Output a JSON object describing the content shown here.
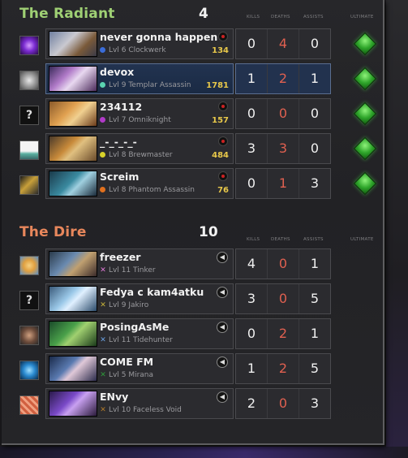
{
  "radiant": {
    "name": "The Radiant",
    "score": "4",
    "color": "#9fd074",
    "headers": {
      "kills": "KILLS",
      "deaths": "DEATHS",
      "assists": "ASSISTS",
      "ultimate": "ULTIMATE"
    },
    "players": [
      {
        "name": "never gonna happen",
        "level": "Lvl 6",
        "hero": "Clockwerk",
        "gold": "134",
        "kills": "0",
        "deaths": "4",
        "assists": "0",
        "dot_color": "#3a6cd8",
        "avatar_icon": "purple-figure-avatar",
        "portrait_icon": "clockwerk-portrait",
        "status_icon": "record-icon",
        "ultimate_ready": true
      },
      {
        "name": "devox",
        "level": "Lvl 9",
        "hero": "Templar Assassin",
        "gold": "1781",
        "kills": "1",
        "deaths": "2",
        "assists": "1",
        "dot_color": "#5ad3b0",
        "avatar_icon": "statue-avatar",
        "portrait_icon": "templar-assassin-portrait",
        "status_icon": "",
        "ultimate_ready": true
      },
      {
        "name": "234112",
        "level": "Lvl 7",
        "hero": "Omniknight",
        "gold": "157",
        "kills": "0",
        "deaths": "0",
        "assists": "0",
        "dot_color": "#b03ac8",
        "avatar_icon": "question-avatar",
        "portrait_icon": "omniknight-portrait",
        "status_icon": "record-icon",
        "ultimate_ready": true
      },
      {
        "name": "_-_-_-_-",
        "level": "Lvl 8",
        "hero": "Brewmaster",
        "gold": "484",
        "kills": "3",
        "deaths": "3",
        "assists": "0",
        "dot_color": "#d8d22a",
        "avatar_icon": "landscape-avatar",
        "portrait_icon": "brewmaster-portrait",
        "status_icon": "record-icon",
        "ultimate_ready": true
      },
      {
        "name": "Screim",
        "level": "Lvl 8",
        "hero": "Phantom Assassin",
        "gold": "76",
        "kills": "0",
        "deaths": "1",
        "assists": "3",
        "dot_color": "#e0701e",
        "avatar_icon": "suit-man-avatar",
        "portrait_icon": "phantom-assassin-portrait",
        "status_icon": "record-icon",
        "ultimate_ready": true
      }
    ]
  },
  "dire": {
    "name": "The Dire",
    "score": "10",
    "color": "#e8875c",
    "headers": {
      "kills": "KILLS",
      "deaths": "DEATHS",
      "assists": "ASSISTS",
      "ultimate": "ULTIMATE"
    },
    "players": [
      {
        "name": "freezer",
        "level": "Lvl 11",
        "hero": "Tinker",
        "kills": "4",
        "deaths": "0",
        "assists": "1",
        "x_color": "#e07ad8",
        "avatar_icon": "blonde-cartoon-avatar",
        "portrait_icon": "tinker-portrait",
        "status_icon": "speaker-icon"
      },
      {
        "name": "Fedya c kam4atku",
        "level": "Lvl 9",
        "hero": "Jakiro",
        "kills": "3",
        "deaths": "0",
        "assists": "5",
        "x_color": "#c8b43a",
        "avatar_icon": "question-avatar",
        "portrait_icon": "jakiro-portrait",
        "status_icon": "speaker-icon"
      },
      {
        "name": "PosingAsMe",
        "level": "Lvl 11",
        "hero": "Tidehunter",
        "kills": "0",
        "deaths": "2",
        "assists": "1",
        "x_color": "#6aa0e0",
        "avatar_icon": "man-photo-avatar",
        "portrait_icon": "tidehunter-portrait",
        "status_icon": "speaker-icon"
      },
      {
        "name": "COME FM",
        "level": "Lvl 5",
        "hero": "Mirana",
        "kills": "1",
        "deaths": "2",
        "assists": "5",
        "x_color": "#2e9a3a",
        "avatar_icon": "blue-swirl-avatar",
        "portrait_icon": "mirana-portrait",
        "status_icon": "speaker-icon"
      },
      {
        "name": "ENvy",
        "level": "Lvl 10",
        "hero": "Faceless Void",
        "kills": "2",
        "deaths": "0",
        "assists": "3",
        "x_color": "#b07a2a",
        "avatar_icon": "red-pattern-avatar",
        "portrait_icon": "faceless-void-portrait",
        "status_icon": "speaker-icon"
      }
    ]
  }
}
